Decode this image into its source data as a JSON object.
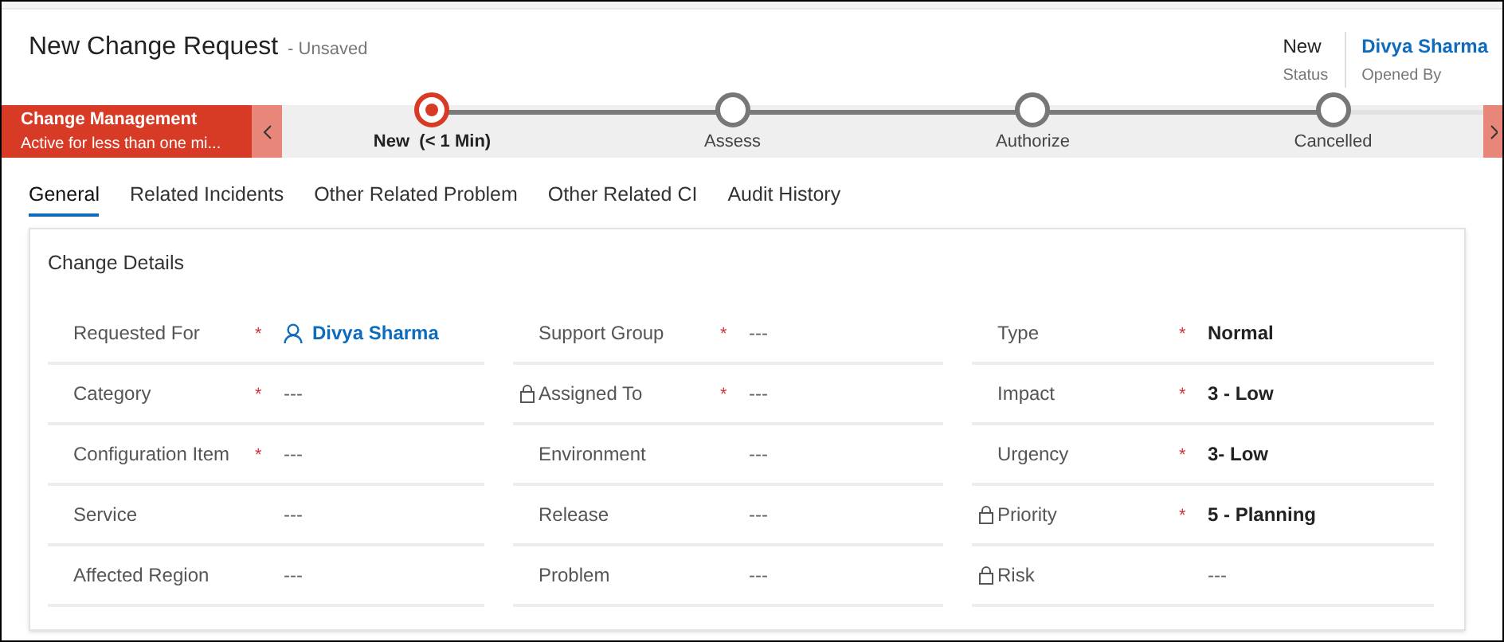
{
  "header": {
    "title": "New Change Request",
    "save_state": "- Unsaved",
    "status_value": "New",
    "status_label": "Status",
    "owner_value": "Divya Sharma",
    "owner_label": "Opened By"
  },
  "process": {
    "name": "Change Management",
    "subtitle": "Active for less than one mi...",
    "stages": [
      {
        "label": "New  (< 1 Min)",
        "selected": true
      },
      {
        "label": "Assess",
        "selected": false
      },
      {
        "label": "Authorize",
        "selected": false
      },
      {
        "label": "Cancelled",
        "selected": false
      }
    ]
  },
  "tabs": [
    {
      "label": "General",
      "selected": true
    },
    {
      "label": "Related Incidents",
      "selected": false
    },
    {
      "label": "Other Related Problem",
      "selected": false
    },
    {
      "label": "Other Related CI",
      "selected": false
    },
    {
      "label": "Audit History",
      "selected": false
    }
  ],
  "section": {
    "title": "Change Details",
    "columns": [
      [
        {
          "label": "Requested For",
          "required_mark": "*",
          "locked": false,
          "kind": "lookup",
          "value": "Divya Sharma"
        },
        {
          "label": "Category",
          "required_mark": "*",
          "locked": false,
          "kind": "empty",
          "value": "---"
        },
        {
          "label": "Configuration Item",
          "required_mark": "*",
          "locked": false,
          "kind": "empty",
          "value": "---"
        },
        {
          "label": "Service",
          "locked": false,
          "kind": "empty",
          "value": "---"
        },
        {
          "label": "Affected Region",
          "locked": false,
          "kind": "empty",
          "value": "---"
        }
      ],
      [
        {
          "label": "Support Group",
          "required_mark": "*",
          "locked": false,
          "kind": "empty",
          "value": "---"
        },
        {
          "label": "Assigned To",
          "required_mark": "*",
          "locked": true,
          "kind": "empty",
          "value": "---"
        },
        {
          "label": "Environment",
          "locked": false,
          "kind": "empty",
          "value": "---"
        },
        {
          "label": "Release",
          "locked": false,
          "kind": "empty",
          "value": "---"
        },
        {
          "label": "Problem",
          "locked": false,
          "kind": "empty",
          "value": "---"
        }
      ],
      [
        {
          "label": "Type",
          "required_mark": "*",
          "locked": false,
          "kind": "text",
          "value": "Normal"
        },
        {
          "label": "Impact",
          "required_mark": "*",
          "locked": false,
          "kind": "text",
          "value": "3 - Low"
        },
        {
          "label": "Urgency",
          "required_mark": "*",
          "locked": false,
          "kind": "text",
          "value": "3- Low"
        },
        {
          "label": "Priority",
          "required_mark": "*",
          "locked": true,
          "kind": "text",
          "value": "5 - Planning"
        },
        {
          "label": "Risk",
          "locked": true,
          "kind": "empty",
          "value": "---"
        }
      ]
    ]
  }
}
